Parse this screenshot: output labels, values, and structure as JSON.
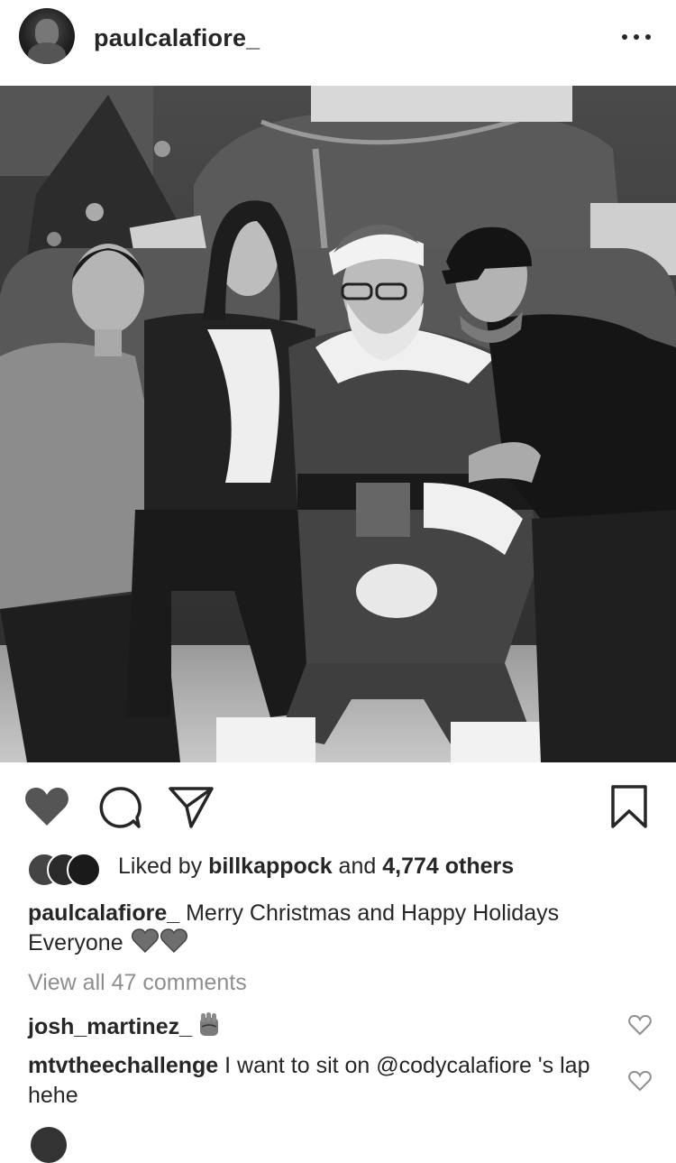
{
  "post": {
    "username": "paulcalafiore_",
    "image_alt": "Black and white photo of three people posing with Santa Claus",
    "likes": {
      "prefix": "Liked by ",
      "liker": "billkappock",
      "middle": " and ",
      "count_text": "4,774 others"
    },
    "caption": {
      "username": "paulcalafiore_",
      "text": " Merry Christmas and Happy Holidays Everyone"
    },
    "view_all": "View all 47 comments",
    "comments": [
      {
        "username": "josh_martinez_",
        "text": ""
      },
      {
        "username": "mtvtheechallenge",
        "text": " I want to sit on @codycalafiore 's lap hehe"
      }
    ]
  },
  "icons": {
    "more": "more-horizontal-icon",
    "like": "heart-filled-icon",
    "comment": "comment-bubble-icon",
    "share": "paper-plane-icon",
    "save": "bookmark-icon"
  },
  "colors": {
    "text": "#262626",
    "muted": "#8e8e8e",
    "icon": "#262626",
    "like_grey": "#555555"
  }
}
